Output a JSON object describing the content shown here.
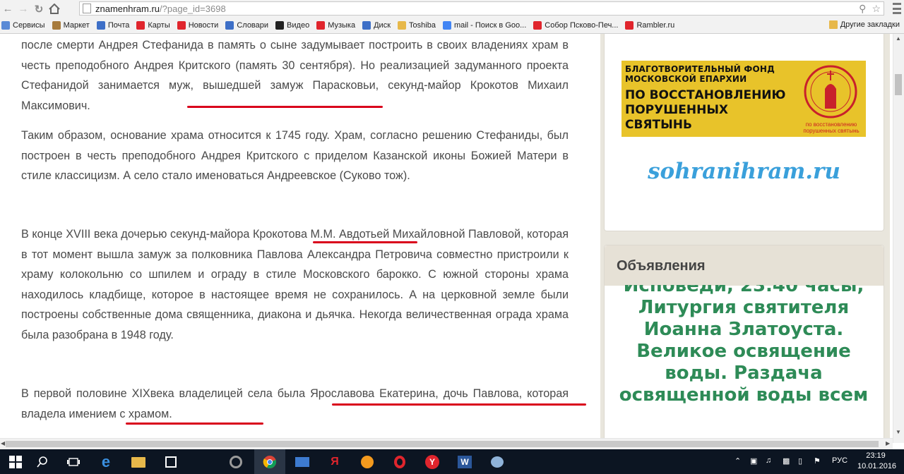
{
  "browser": {
    "url_host": "znamenhram.ru",
    "url_path": "/?page_id=3698"
  },
  "bookmarks": [
    {
      "label": "Сервисы",
      "icon": "apps-grid-icon",
      "color": "#5a8ad6"
    },
    {
      "label": "Маркет",
      "icon": "market-icon",
      "color": "#a77b3d"
    },
    {
      "label": "Почта",
      "icon": "mail-icon",
      "color": "#3d6fc7"
    },
    {
      "label": "Карты",
      "icon": "map-pin-icon",
      "color": "#e0252d"
    },
    {
      "label": "Новости",
      "icon": "news-icon",
      "color": "#e0252d"
    },
    {
      "label": "Словари",
      "icon": "dictionary-icon",
      "color": "#3d6fc7"
    },
    {
      "label": "Видео",
      "icon": "video-icon",
      "color": "#222222"
    },
    {
      "label": "Музыка",
      "icon": "music-icon",
      "color": "#e0252d"
    },
    {
      "label": "Диск",
      "icon": "disk-icon",
      "color": "#3d6fc7"
    },
    {
      "label": "Toshiba",
      "icon": "folder-icon",
      "color": "#e7b84a"
    },
    {
      "label": "mail - Поиск в Goo...",
      "icon": "google-icon",
      "color": "#4285f4"
    },
    {
      "label": "Собор Псково-Печ...",
      "icon": "yandex-icon",
      "color": "#e0252d"
    },
    {
      "label": "Rambler.ru",
      "icon": "yandex-icon",
      "color": "#e0252d"
    }
  ],
  "other_bookmarks": "Другие закладки",
  "article": {
    "p1": "после смерти Андрея Стефанида в память о сыне задумывает построить в своих владениях храм в честь преподобного Андрея Критского (память 30 сентября). Но реализацией задуманного проекта Стефанидой занимается муж, вышедшей замуж Парасковьи, секунд-майор Крокотов Михаил Максимович.",
    "p2": "Таким образом, основание храма относится к 1745 году. Храм, согласно решению Стефаниды, был построен в честь преподобного Андрея Критского  с приделом Казанской иконы Божией Матери в стиле классицизм. А село стало именоваться Андреевское (Суково тож).",
    "p3": "В конце XVIII века дочерью секунд-майора Крокотова М.М. Авдотьей Михайловной Павловой, которая в тот момент вышла замуж за полковника Павлова Александра Петровича совместно пристроили к храму колокольню со шпилем и ограду в стиле Московского барокко. С южной стороны храма находилось кладбище, которое в настоящее время не сохранилось. А на церковной земле были построены собственные дома священника, диакона и дьячка. Некогда величественная ограда храма была разобрана в 1948 году.",
    "p4": "В первой половине XIXвека владелицей села была Ярославова Екатерина, дочь Павлова, которая владела имением с храмом."
  },
  "banner": {
    "line1": "Благотворительный фонд московской епархии",
    "line2": "По восстановлению порушенных святынь",
    "small": "по восстановлению порушенных святынь",
    "accent": "#e8c32a"
  },
  "sidebar": {
    "site_link": "sohranihram.ru",
    "announce_title": "Объявления",
    "announce_text": "Исповеди, 23.40 часы, Литургия святителя Иоанна Златоуста. Великое освящение воды. Раздача освященной воды всем"
  },
  "taskbar": {
    "lang": "РУС",
    "time": "23:19",
    "date": "10.01.2016"
  }
}
